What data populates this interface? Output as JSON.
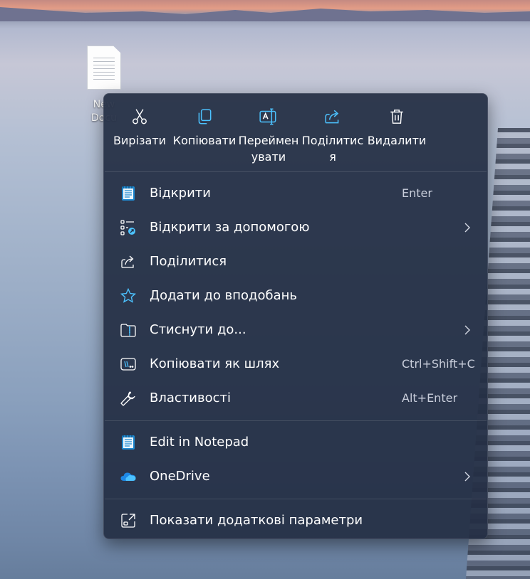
{
  "desktop": {
    "file_label_line1": "New",
    "file_label_line2": "Docu"
  },
  "toolbar": [
    {
      "icon": "scissors-icon",
      "label": "Вирізати"
    },
    {
      "icon": "copy-icon",
      "label": "Копіювати"
    },
    {
      "icon": "rename-icon",
      "label": "Перейменувати"
    },
    {
      "icon": "share-icon",
      "label": "Поділитися"
    },
    {
      "icon": "trash-icon",
      "label": "Видалити"
    }
  ],
  "items": [
    {
      "icon": "notepad-icon",
      "label": "Відкрити",
      "shortcut": "Enter"
    },
    {
      "icon": "open-with-icon",
      "label": "Відкрити за допомогою",
      "submenu": true
    },
    {
      "icon": "share-icon",
      "label": "Поділитися"
    },
    {
      "icon": "star-icon",
      "label": "Додати до вподобань"
    },
    {
      "icon": "zip-folder-icon",
      "label": "Стиснути до...",
      "submenu": true
    },
    {
      "icon": "copy-path-icon",
      "label": "Копіювати як шлях",
      "shortcut": "Ctrl+Shift+C"
    },
    {
      "icon": "wrench-icon",
      "label": "Властивості",
      "shortcut": "Alt+Enter"
    },
    {
      "icon": "notepad-icon",
      "label": "Edit in Notepad"
    },
    {
      "icon": "onedrive-icon",
      "label": "OneDrive",
      "submenu": true
    },
    {
      "icon": "more-options-icon",
      "label": "Показати додаткові параметри"
    }
  ],
  "colors": {
    "menu_background": "#242e44",
    "accent": "#4cc2ff",
    "text": "#ffffff",
    "shortcut_text": "#c9cedb"
  }
}
